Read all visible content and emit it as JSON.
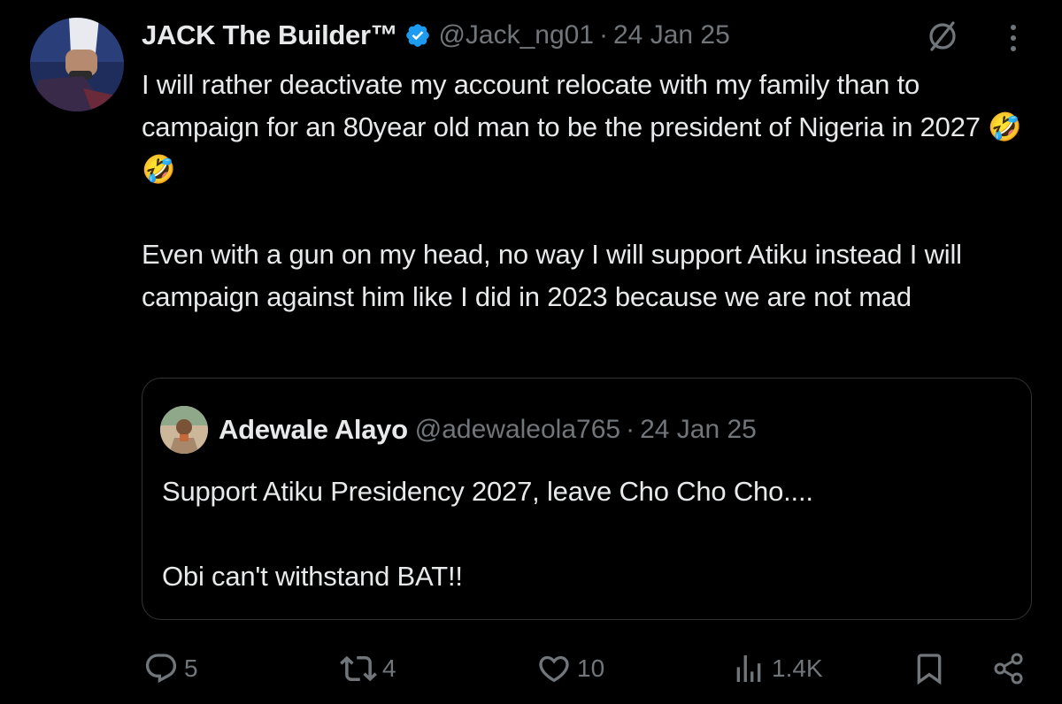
{
  "tweet": {
    "author_name": "JACK The Builder™",
    "handle": "@Jack_ng01",
    "separator": "·",
    "time": "24 Jan 25",
    "text": "I will rather deactivate my account relocate with my family than to campaign for an 80year old man to be the president of Nigeria in 2027 🤣🤣\n\nEven with a gun on my head, no way I will support Atiku instead I will campaign against him like I did in 2023 because we are not mad"
  },
  "quote": {
    "author_name": "Adewale Alayo",
    "handle": "@adewaleola765",
    "separator": "·",
    "time": "24 Jan 25",
    "text": "Support Atiku Presidency 2027, leave Cho Cho Cho....\n\nObi can't withstand BAT!!"
  },
  "actions": {
    "replies": "5",
    "reposts": "4",
    "likes": "10",
    "views": "1.4K"
  },
  "icons": {
    "verified": "verified-badge-icon",
    "grok": "grok-icon",
    "more": "more-vertical-icon",
    "reply": "reply-icon",
    "repost": "repost-icon",
    "like": "heart-icon",
    "views": "views-icon",
    "bookmark": "bookmark-icon",
    "share": "share-icon"
  },
  "colors": {
    "background": "#000000",
    "text": "#e7e9ea",
    "muted": "#71767b",
    "verified": "#1d9bf0",
    "border": "#2f3336"
  }
}
